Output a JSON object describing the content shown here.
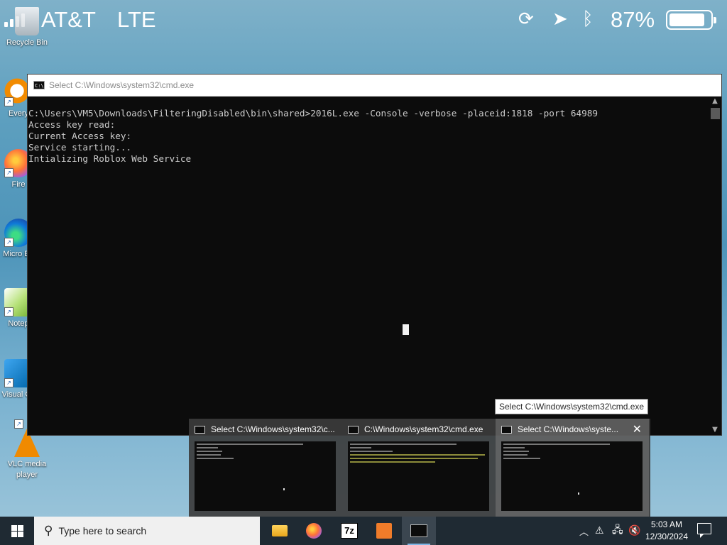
{
  "status_bar": {
    "carrier": "AT&T",
    "network": "LTE",
    "battery_percent": "87%",
    "battery_level": 0.87
  },
  "desktop_icons": [
    {
      "label": "Recycle Bin",
      "icon": "recycle-bin-icon"
    },
    {
      "label": "Every",
      "icon": "everything-icon"
    },
    {
      "label": "Fire",
      "icon": "firefox-icon"
    },
    {
      "label": "Micro Ed",
      "icon": "edge-icon"
    },
    {
      "label": "Notep",
      "icon": "notepad-plus-icon"
    },
    {
      "label": "Visual Co",
      "icon": "vscode-icon"
    },
    {
      "label": "VLC media player",
      "icon": "vlc-icon"
    }
  ],
  "cmd_window": {
    "title": "Select C:\\Windows\\system32\\cmd.exe",
    "lines": [
      "C:\\Users\\VM5\\Downloads\\FilteringDisabled\\bin\\shared>2016L.exe -Console -verbose -placeid:1818 -port 64989",
      "Access key read:",
      "Current Access key:",
      "Service starting...",
      "Intializing Roblox Web Service"
    ]
  },
  "tooltip": "Select C:\\Windows\\system32\\cmd.exe",
  "previews": [
    {
      "title": "Select C:\\Windows\\system32\\c..."
    },
    {
      "title": "C:\\Windows\\system32\\cmd.exe"
    },
    {
      "title": "Select C:\\Windows\\syste..."
    }
  ],
  "taskbar": {
    "search_placeholder": "Type here to search",
    "apps": [
      "file-explorer-icon",
      "firefox-icon",
      "7zip-icon",
      "lab-flask-icon",
      "cmd-icon"
    ],
    "time": "5:03 AM",
    "date": "12/30/2024"
  },
  "colors": {
    "console_bg": "#0c0c0c",
    "console_text": "#cccccc",
    "taskbar_bg": "#1f2a33"
  }
}
